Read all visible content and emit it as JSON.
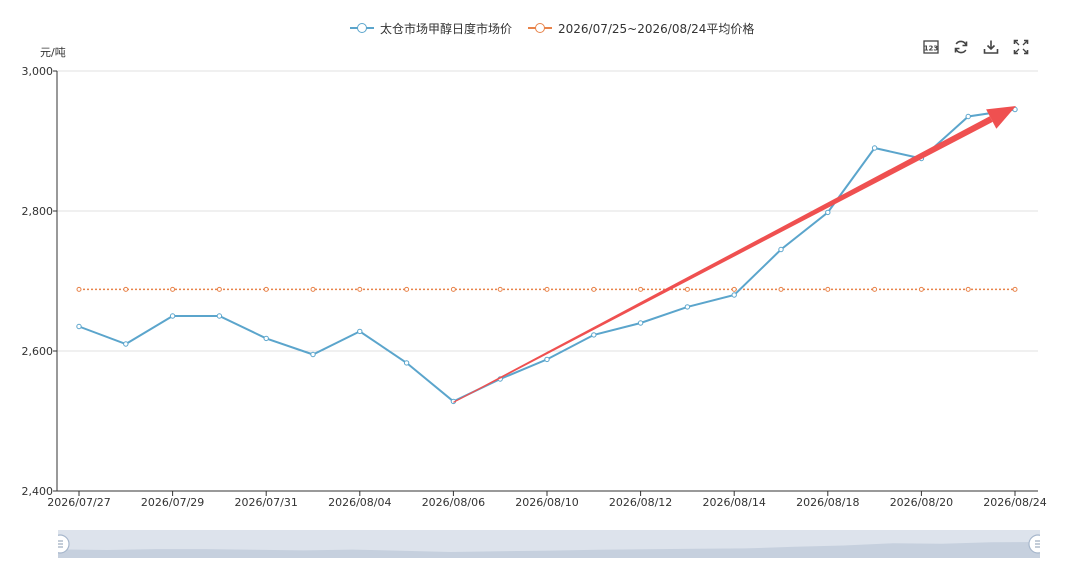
{
  "legend": {
    "series1_label": "太仓市场甲醇日度市场价",
    "series2_label": "2026/07/25~2026/08/24平均价格"
  },
  "toolbox": {
    "data_view_icon": "data-view-icon",
    "restore_icon": "restore-icon",
    "download_icon": "download-icon",
    "fullscreen_icon": "fullscreen-icon"
  },
  "colors": {
    "series1": "#5ba5cc",
    "series2": "#e8834a",
    "arrow": "#ef5050"
  },
  "chart_data": {
    "type": "line",
    "ylabel": "元/吨",
    "ylim": [
      2400,
      3000
    ],
    "yticks": [
      "3,000",
      "2,800",
      "2,600",
      "2,400"
    ],
    "ytick_values": [
      3000,
      2800,
      2600,
      2400
    ],
    "xtick_labels": [
      "2026/07/27",
      "2026/07/29",
      "2026/07/31",
      "2026/08/04",
      "2026/08/06",
      "2026/08/10",
      "2026/08/12",
      "2026/08/14",
      "2026/08/18",
      "2026/08/20",
      "2026/08/24"
    ],
    "series": [
      {
        "name": "太仓市场甲醇日度市场价",
        "values": [
          2635,
          2610,
          2650,
          2650,
          2618,
          2595,
          2628,
          2583,
          2528,
          2560,
          2588,
          2623,
          2640,
          2663,
          2680,
          2745,
          2798,
          2890,
          2875,
          2935,
          2945
        ]
      },
      {
        "name": "2026/07/25~2026/08/24平均价格",
        "values": [
          2688,
          2688,
          2688,
          2688,
          2688,
          2688,
          2688,
          2688,
          2688,
          2688,
          2688,
          2688,
          2688,
          2688,
          2688,
          2688,
          2688,
          2688,
          2688,
          2688,
          2688
        ]
      }
    ],
    "legend_position": "top-center",
    "grid": "horizontal",
    "annotation": "trend-arrow"
  }
}
